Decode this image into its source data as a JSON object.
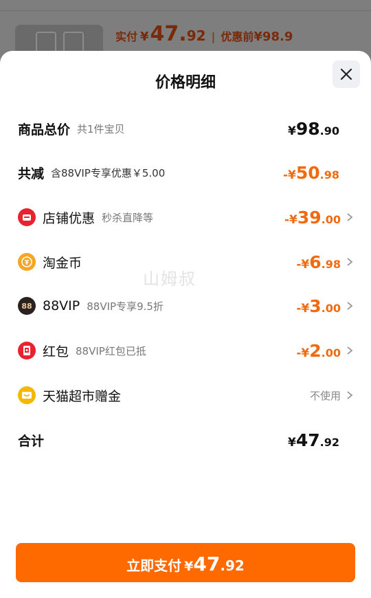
{
  "background": {
    "paid_label": "实付",
    "paid_symbol": "¥",
    "paid_int": "47.",
    "paid_dec": "92",
    "original_label": "优惠前",
    "original_value": "¥98.9"
  },
  "sheet": {
    "title": "价格明细",
    "watermark": "山姆叔"
  },
  "rows": {
    "total": {
      "label": "商品总价",
      "sub": "共1件宝贝",
      "symbol": "¥",
      "int": "98",
      "dec": ".90"
    },
    "reduce": {
      "label": "共减",
      "sub": "含88VIP专享优惠￥5.00",
      "symbol": "-¥",
      "int": "50",
      "dec": ".98"
    },
    "shop": {
      "label": "店铺优惠",
      "sub": "秒杀直降等",
      "symbol": "-¥",
      "int": "39",
      "dec": ".00",
      "icon": "shop-coupon-icon",
      "color": "#e8232f"
    },
    "coin": {
      "label": "淘金币",
      "symbol": "-¥",
      "int": "6",
      "dec": ".98",
      "icon": "gold-coin-icon",
      "color": "#f5a623"
    },
    "vip": {
      "label": "88VIP",
      "sub": "88VIP专享9.5折",
      "symbol": "-¥",
      "int": "3",
      "dec": ".00",
      "icon": "vip88-icon",
      "icon_text": "88",
      "color": "#2b2220"
    },
    "redpack": {
      "label": "红包",
      "sub": "88VIP红包已抵",
      "symbol": "-¥",
      "int": "2",
      "dec": ".00",
      "icon": "red-packet-icon",
      "color": "#e8232f"
    },
    "gift": {
      "label": "天猫超市赠金",
      "note": "不使用",
      "icon": "gift-card-icon",
      "color": "#f5b800"
    },
    "sum": {
      "label": "合计",
      "symbol": "¥",
      "int": "47",
      "dec": ".92"
    }
  },
  "pay_button": {
    "label": "立即支付",
    "symbol": "¥",
    "int": "47",
    "dec": ".92"
  },
  "colors": {
    "accent": "#ff6a00",
    "discount": "#f26a10"
  }
}
